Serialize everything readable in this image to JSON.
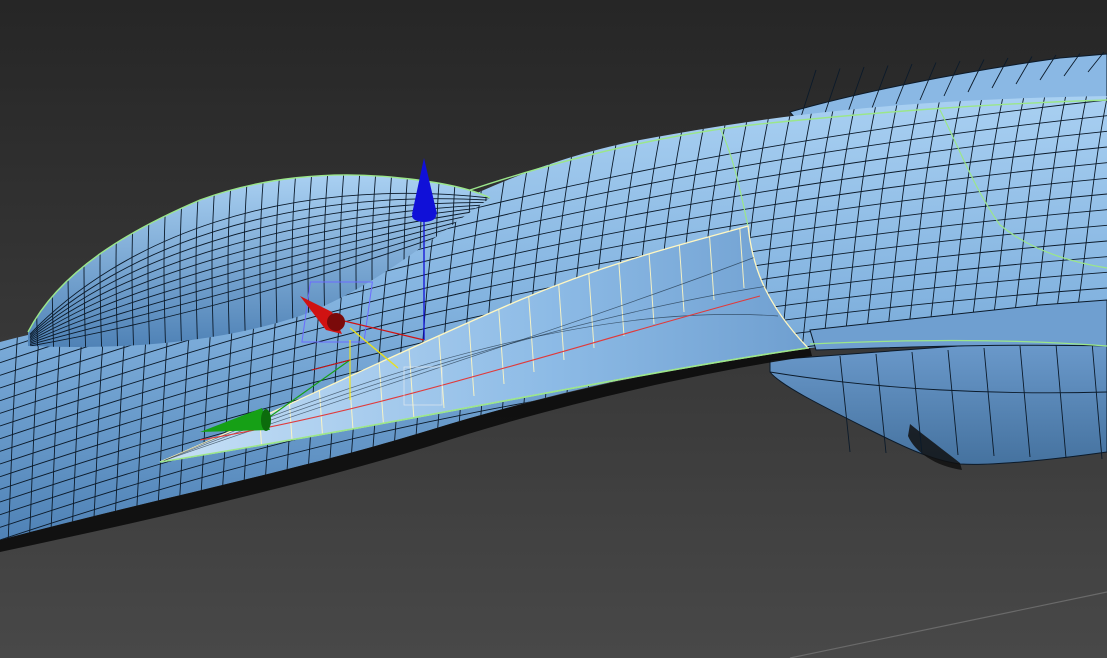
{
  "viewport": {
    "background_top": "#262626",
    "background_bottom": "#484848",
    "mesh_fill": "#7faedc",
    "mesh_fill_light": "#a9d0f2",
    "mesh_fill_dark": "#4f82b6",
    "wire_color": "#0b1a2a",
    "seam_color": "#9be68a",
    "selected_edge_color": "#fff7c2",
    "grid_line_color": "#6a6a6a"
  },
  "gizmo": {
    "x_axis_color": "#d01212",
    "y_axis_color": "#16a016",
    "z_axis_color": "#1010d8",
    "plane_color": "#e8e020"
  }
}
